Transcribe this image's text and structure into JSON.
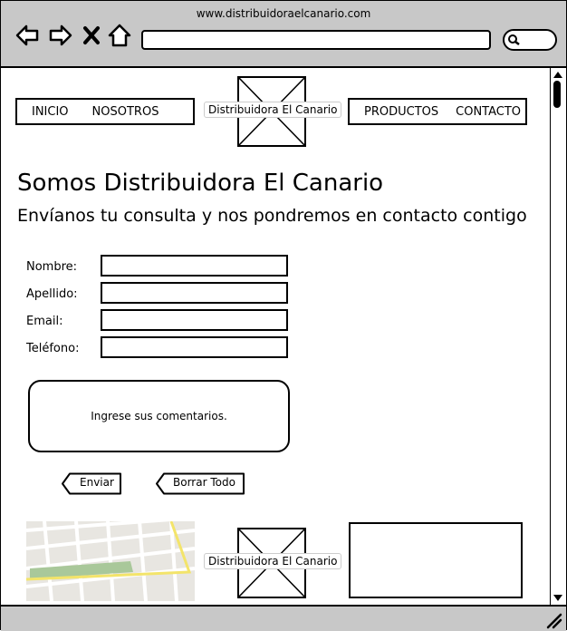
{
  "browser": {
    "url": "www.distribuidoraelcanario.com",
    "icons": [
      "back-arrow-icon",
      "forward-arrow-icon",
      "close-x-icon",
      "home-icon",
      "search-icon"
    ]
  },
  "nav": {
    "left_items": [
      "INICIO",
      "NOSOTROS"
    ],
    "right_items": [
      "PRODUCTOS",
      "CONTACTO"
    ],
    "logo_label": "Distribuidora El Canario"
  },
  "main": {
    "title": "Somos Distribuidora El Canario",
    "subtitle": "Envíanos tu consulta y nos pondremos en contacto contigo"
  },
  "form": {
    "fields": [
      {
        "label": "Nombre:",
        "value": ""
      },
      {
        "label": "Apellido:",
        "value": ""
      },
      {
        "label": "Email:",
        "value": ""
      },
      {
        "label": "Teléfono:",
        "value": ""
      }
    ],
    "comments_placeholder": "Ingrese sus comentarios.",
    "submit_label": "Enviar",
    "clear_label": "Borrar Todo"
  },
  "footer": {
    "logo_label": "Distribuidora El Canario",
    "icons": [
      "map-image",
      "image-placeholder-icon"
    ]
  },
  "colors": {
    "chrome": "#c8c8c8",
    "map_bg": "#e8e6e1",
    "map_road": "#ffffff",
    "map_highlight": "#f3e46a",
    "map_park": "#a9c89a"
  }
}
